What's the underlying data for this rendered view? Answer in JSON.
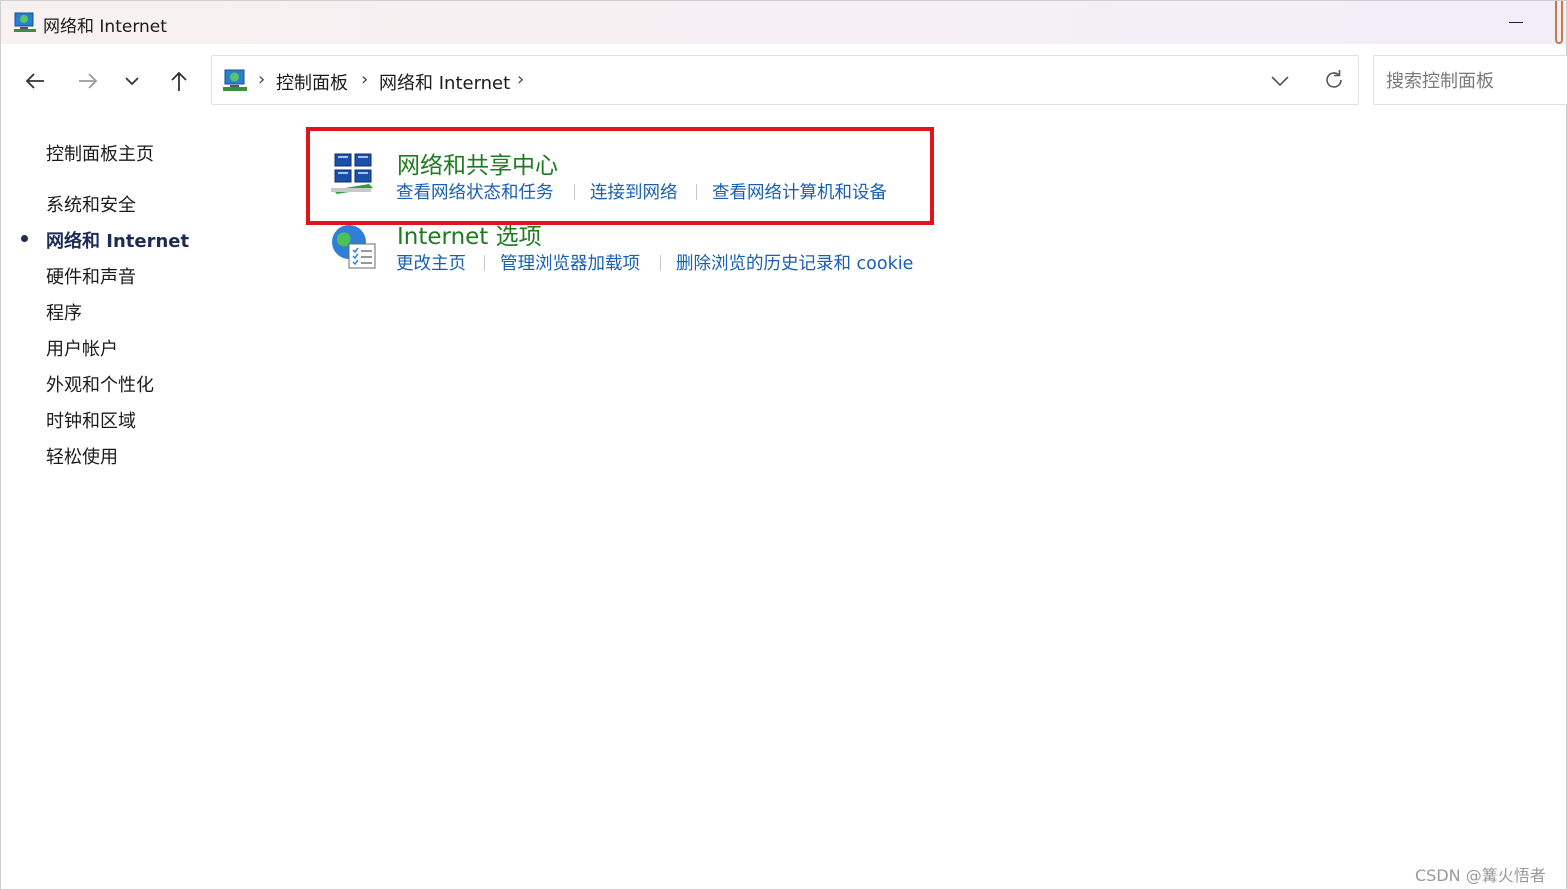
{
  "window": {
    "title": "网络和 Internet"
  },
  "nav": {
    "back": "back",
    "forward": "forward",
    "recent": "recent-locations",
    "up": "up"
  },
  "address": {
    "crumbs": [
      "控制面板",
      "网络和 Internet"
    ],
    "separator": "›"
  },
  "search": {
    "placeholder": "搜索控制面板"
  },
  "sidebar": {
    "items": [
      {
        "label": "控制面板主页",
        "active": false
      },
      {
        "label": "系统和安全",
        "active": false
      },
      {
        "label": "网络和 Internet",
        "active": true
      },
      {
        "label": "硬件和声音",
        "active": false
      },
      {
        "label": "程序",
        "active": false
      },
      {
        "label": "用户帐户",
        "active": false
      },
      {
        "label": "外观和个性化",
        "active": false
      },
      {
        "label": "时钟和区域",
        "active": false
      },
      {
        "label": "轻松使用",
        "active": false
      }
    ]
  },
  "categories": [
    {
      "title": "网络和共享中心",
      "icon": "network-sharing-center-icon",
      "links": [
        "查看网络状态和任务",
        "连接到网络",
        "查看网络计算机和设备"
      ]
    },
    {
      "title": "Internet 选项",
      "icon": "internet-options-icon",
      "links": [
        "更改主页",
        "管理浏览器加载项",
        "删除浏览的历史记录和 cookie"
      ]
    }
  ],
  "colors": {
    "category_title": "#1f7a1f",
    "task_link": "#1a5fb4",
    "highlight": "#e0141c",
    "active_sidebar": "#1e2b55"
  },
  "watermark": "CSDN @篝火悟者"
}
